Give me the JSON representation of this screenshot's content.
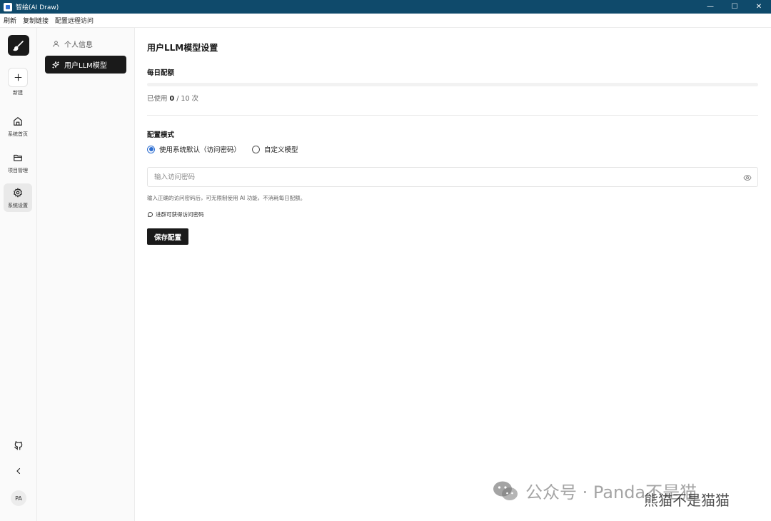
{
  "window": {
    "title": "智绘(AI Draw)",
    "controls": {
      "minimize": "—",
      "maximize": "☐",
      "close": "✕"
    }
  },
  "menubar": {
    "items": [
      "刷新",
      "复制链接",
      "配置远程访问"
    ]
  },
  "rail": {
    "new_label": "新建",
    "items": [
      {
        "label": "系统首页"
      },
      {
        "label": "项目管理"
      },
      {
        "label": "系统设置"
      }
    ],
    "avatar_initials": "PA"
  },
  "subnav": {
    "items": [
      {
        "label": "个人信息"
      },
      {
        "label": "用户LLM模型"
      }
    ]
  },
  "main": {
    "page_title": "用户LLM模型设置",
    "quota": {
      "label": "每日配额",
      "used_prefix": "已使用",
      "used": "0",
      "limit_text": "/ 10 次",
      "used_fraction": 0
    },
    "config_mode": {
      "label": "配置模式",
      "options": [
        "使用系统默认（访问密码）",
        "自定义模型"
      ],
      "selected_index": 0
    },
    "password": {
      "placeholder": "输入访问密码",
      "value": ""
    },
    "hint": "输入正确的访问密码后，可无限制使用 AI 功能，不消耗每日配额。",
    "group_link": "进群可获得访问密码",
    "save_label": "保存配置"
  },
  "watermark": {
    "text": "公众号 · Panda不是猫",
    "subtext": "熊猫不是猫猫"
  },
  "colors": {
    "titlebar": "#0f4a6b",
    "accent": "#2f6fd1",
    "primary_dark": "#1a1a1a"
  }
}
